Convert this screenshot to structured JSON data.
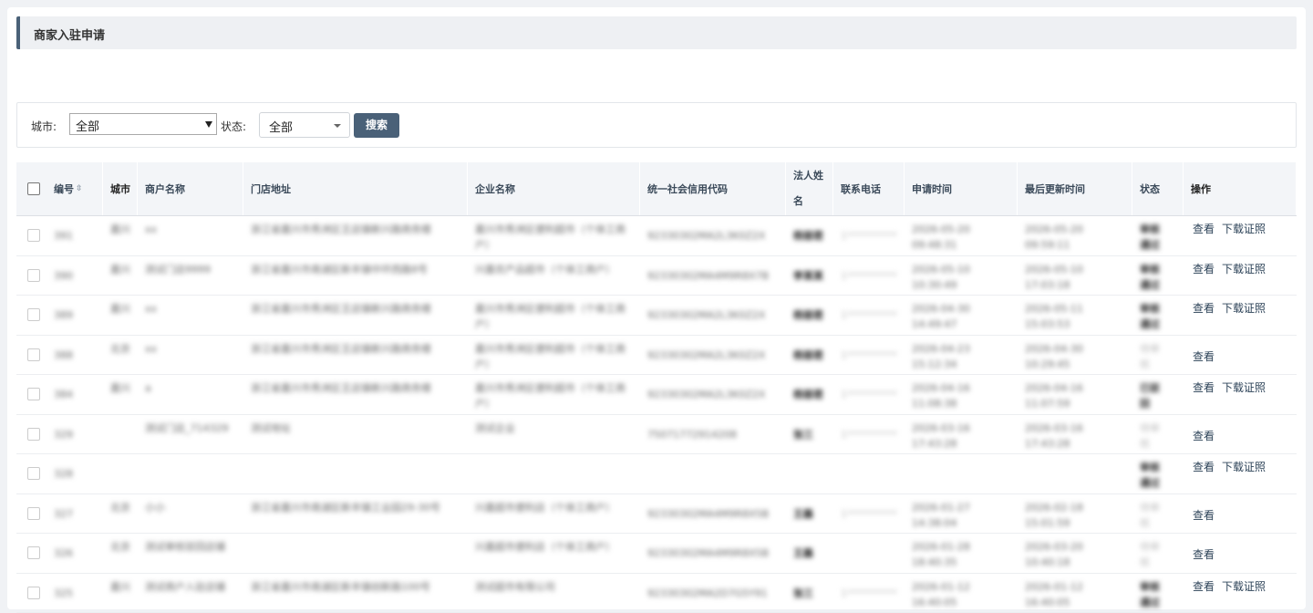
{
  "page": {
    "title": "商家入驻申请"
  },
  "filters": {
    "city_label": "城市:",
    "city_value": "全部",
    "status_label": "状态:",
    "status_value": "全部",
    "search_label": "搜索"
  },
  "table": {
    "headers": {
      "id": "编号",
      "city": "城市",
      "merchant": "商户名称",
      "address": "门店地址",
      "company": "企业名称",
      "credit_code": "统一社会信用代码",
      "legal_name_l1": "法人姓",
      "legal_name_l2": "名",
      "phone": "联系电话",
      "apply_time": "申请时间",
      "update_time": "最后更新时间",
      "status": "状态",
      "action": "操作"
    },
    "actions": {
      "view": "查看",
      "download": "下载证照"
    },
    "rows": [
      {
        "id": "391",
        "city": "嘉兴",
        "merchant": "xx",
        "address": "浙江省嘉兴市秀洲区王店镇新兴路商务楼",
        "company": "嘉兴市秀洲区便利超市（个体工商户）",
        "code": "92330302MA2L3K0Z2X",
        "legal": "杨丽君",
        "phone": "1**********",
        "apply": "2026-05-20 09:48:31",
        "update": "2026-05-20 09:59:11",
        "status": "审核通过",
        "download": true
      },
      {
        "id": "390",
        "city": "嘉兴",
        "merchant": "测试门店9999",
        "address": "浙江省嘉兴市南湖区新丰镇中环西路8号",
        "company": "兴嘉农产品超市（个体工商户）",
        "code": "92330302MA4M9R8X7B",
        "legal": "李某某",
        "phone": "1**********",
        "apply": "2026-05-10 10:30:49",
        "update": "2026-05-10 17:03:18",
        "status": "审核通过",
        "download": true
      },
      {
        "id": "389",
        "city": "嘉兴",
        "merchant": "xx",
        "address": "浙江省嘉兴市秀洲区王店镇新兴路商务楼",
        "company": "嘉兴市秀洲区便利超市（个体工商户）",
        "code": "92330302MA2L3K0Z2X",
        "legal": "杨丽君",
        "phone": "1**********",
        "apply": "2026-04-30 14:49:47",
        "update": "2026-05-11 15:03:53",
        "status": "审核通过",
        "download": true
      },
      {
        "id": "388",
        "city": "北京",
        "merchant": "xx",
        "address": "浙江省嘉兴市秀洲区王店镇新兴路商务楼",
        "company": "嘉兴市秀洲区便利超市（个体工商户）",
        "code": "92330302MA2L3K0Z2X",
        "legal": "杨丽君",
        "phone": "1**********",
        "apply": "2026-04-23 15:12:34",
        "update": "2026-04-30 10:29:45",
        "status": "待审核",
        "download": false
      },
      {
        "id": "384",
        "city": "嘉兴",
        "merchant": "a",
        "address": "浙江省嘉兴市秀洲区王店镇新兴路商务楼",
        "company": "嘉兴市秀洲区便利超市（个体工商户）",
        "code": "92330302MA2L3K0Z2X",
        "legal": "杨丽君",
        "phone": "1**********",
        "apply": "2026-04-16 11:08:38",
        "update": "2026-04-16 11:07:59",
        "status": "已驳回",
        "download": true
      },
      {
        "id": "329",
        "city": "",
        "merchant": "测试门店_714329",
        "address": "测试地址",
        "company": "测试企业",
        "code": "75071772914208",
        "legal": "张三",
        "phone": "1**********",
        "apply": "2026-03-16 17:43:28",
        "update": "2026-03-16 17:43:28",
        "status": "待审核",
        "download": false
      },
      {
        "id": "328",
        "city": "",
        "merchant": "",
        "address": "",
        "company": "",
        "code": "",
        "legal": "",
        "phone": "",
        "apply": "",
        "update": "",
        "status": "审核通过",
        "download": true
      },
      {
        "id": "327",
        "city": "北京",
        "merchant": "小小",
        "address": "浙江省嘉兴市南湖区新丰镇工业园29-30号",
        "company": "兴嘉超市便利店（个体工商户）",
        "code": "92330302MA4M9R8X5B",
        "legal": "王磊",
        "phone": "1**********",
        "apply": "2026-01-27 14:38:04",
        "update": "2026-02-18 15:01:59",
        "status": "待审核",
        "download": false
      },
      {
        "id": "326",
        "city": "北京",
        "merchant": "测试审核驳回店铺",
        "address": "",
        "company": "兴嘉超市便利店（个体工商户）",
        "code": "92330302MA4M9R8X5B",
        "legal": "王磊",
        "phone": "",
        "apply": "2026-01-28 18:40:35",
        "update": "2026-03-20 10:40:18",
        "status": "待审核",
        "download": false
      },
      {
        "id": "325",
        "city": "嘉兴",
        "merchant": "测试商户入驻店铺",
        "address": "浙江省嘉兴市南湖区新丰镇创新路100号",
        "company": "测试超市有限公司",
        "code": "92330302MA2D7G5Y91",
        "legal": "张三",
        "phone": "1**********",
        "apply": "2026-01-12 16:40:05",
        "update": "2026-01-12 16:40:05",
        "status": "审核通过",
        "download": true
      }
    ]
  }
}
